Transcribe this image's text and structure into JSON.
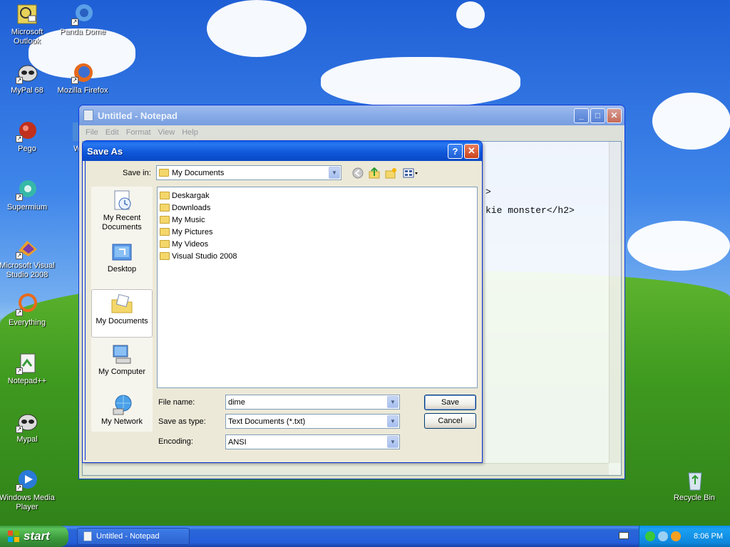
{
  "desktop": {
    "icons": [
      {
        "label": "Microsoft Outlook"
      },
      {
        "label": "Panda Dome"
      },
      {
        "label": "MyPal 68"
      },
      {
        "label": "Mozilla Firefox"
      },
      {
        "label": "Pego"
      },
      {
        "label": "Wi"
      },
      {
        "label": "Supermium"
      },
      {
        "label": "Microsoft Visual Studio 2008"
      },
      {
        "label": "Everything"
      },
      {
        "label": "Notepad++"
      },
      {
        "label": "Mypal"
      },
      {
        "label": "Windows Media Player"
      },
      {
        "label": "Recycle Bin"
      }
    ]
  },
  "notepad": {
    "title": "Untitled - Notepad",
    "menu": [
      "File",
      "Edit",
      "Format",
      "View",
      "Help"
    ],
    "text_lines": [
      ">",
      "kie monster</h2>"
    ]
  },
  "dialog": {
    "title": "Save As",
    "help_glyph": "?",
    "close_glyph": "✕",
    "save_in_label": "Save in:",
    "save_in_value": "My Documents",
    "places": [
      {
        "label": "My Recent Documents"
      },
      {
        "label": "Desktop"
      },
      {
        "label": "My Documents"
      },
      {
        "label": "My Computer"
      },
      {
        "label": "My Network"
      }
    ],
    "files": [
      {
        "name": "Deskargak"
      },
      {
        "name": "Downloads"
      },
      {
        "name": "My Music"
      },
      {
        "name": "My Pictures"
      },
      {
        "name": "My Videos"
      },
      {
        "name": "Visual Studio 2008"
      }
    ],
    "file_name_label": "File name:",
    "file_name_value": "dime",
    "save_as_type_label": "Save as type:",
    "save_as_type_value": "Text Documents (*.txt)",
    "encoding_label": "Encoding:",
    "encoding_value": "ANSI",
    "save_button": "Save",
    "cancel_button": "Cancel"
  },
  "taskbar": {
    "start_label": "start",
    "task_label": "Untitled - Notepad",
    "clock": "8:06 PM"
  },
  "colors": {
    "dialog_title": "#0a5fe8",
    "start_green": "#3c9a3c",
    "taskbar_blue": "#245edb",
    "tray_blue": "#0e87dd"
  }
}
